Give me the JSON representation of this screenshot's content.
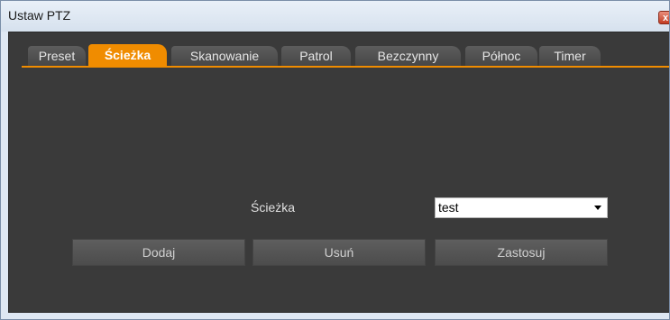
{
  "window": {
    "title": "Ustaw PTZ",
    "close_label": "x"
  },
  "tabs": [
    {
      "label": "Preset",
      "active": false
    },
    {
      "label": "Ścieżka",
      "active": true
    },
    {
      "label": "Skanowanie",
      "active": false
    },
    {
      "label": "Patrol",
      "active": false
    },
    {
      "label": "Bezczynny",
      "active": false
    },
    {
      "label": "Północ",
      "active": false
    },
    {
      "label": "Timer",
      "active": false
    }
  ],
  "form": {
    "path_label": "Ścieżka",
    "path_value": "test"
  },
  "buttons": {
    "add_label": "Dodaj",
    "remove_label": "Usuń",
    "apply_label": "Zastosuj"
  },
  "colors": {
    "accent": "#f08c00",
    "panel": "#3a3a3a"
  }
}
